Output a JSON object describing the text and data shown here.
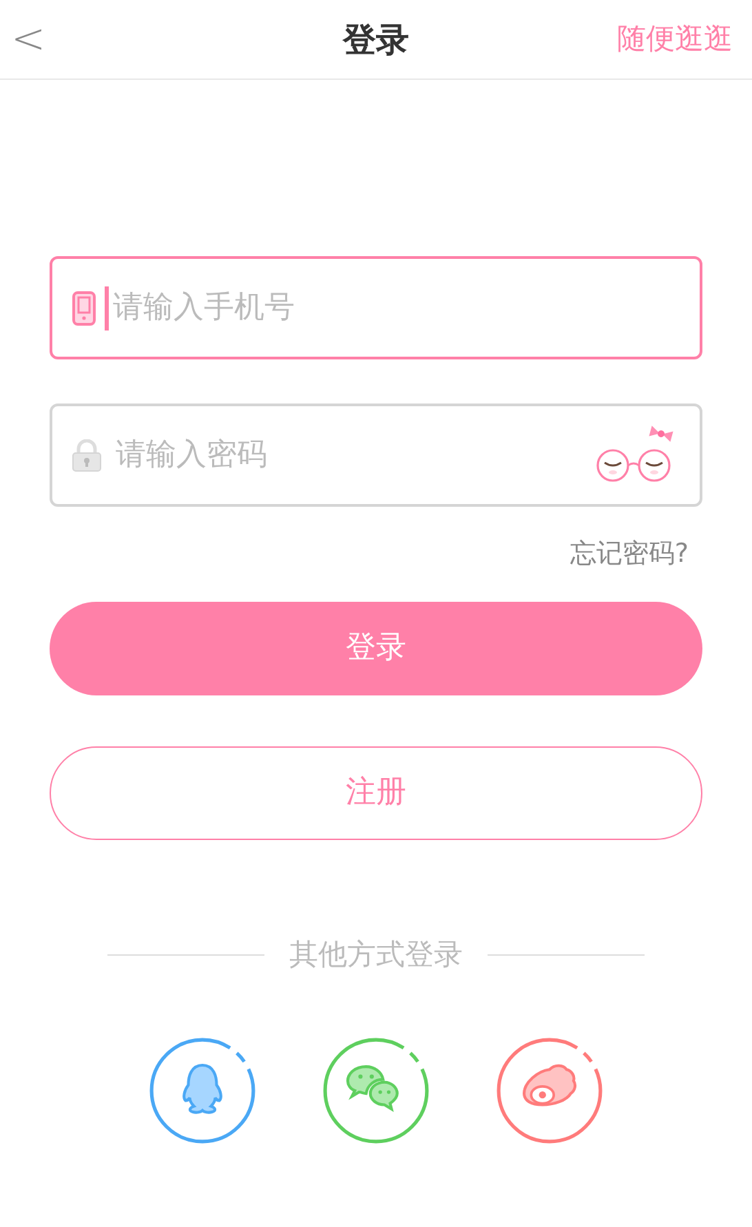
{
  "header": {
    "back": "<",
    "title": "登录",
    "action": "随便逛逛"
  },
  "fields": [
    {
      "kind": "phone",
      "placeholder": "请输入手机号",
      "focused": true
    },
    {
      "kind": "password",
      "placeholder": "请输入密码",
      "focused": false
    }
  ],
  "forgot_link": "忘记密码?",
  "login_button": "登录",
  "register_button": "注册",
  "divider_text": "其他方式登录",
  "social": [
    {
      "kind": "qq"
    },
    {
      "kind": "wechat"
    },
    {
      "kind": "weibo"
    }
  ]
}
